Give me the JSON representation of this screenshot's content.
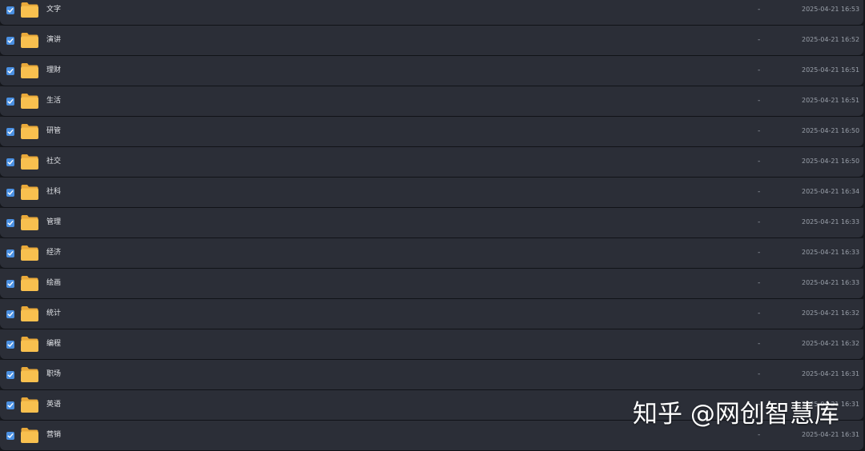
{
  "rows": [
    {
      "name": "文字",
      "size": "-",
      "date": "2025-04-21 16:53",
      "checked": true
    },
    {
      "name": "演讲",
      "size": "-",
      "date": "2025-04-21 16:52",
      "checked": true
    },
    {
      "name": "理财",
      "size": "-",
      "date": "2025-04-21 16:51",
      "checked": true
    },
    {
      "name": "生活",
      "size": "-",
      "date": "2025-04-21 16:51",
      "checked": true
    },
    {
      "name": "研管",
      "size": "-",
      "date": "2025-04-21 16:50",
      "checked": true
    },
    {
      "name": "社交",
      "size": "-",
      "date": "2025-04-21 16:50",
      "checked": true
    },
    {
      "name": "社科",
      "size": "-",
      "date": "2025-04-21 16:34",
      "checked": true
    },
    {
      "name": "管理",
      "size": "-",
      "date": "2025-04-21 16:33",
      "checked": true
    },
    {
      "name": "经济",
      "size": "-",
      "date": "2025-04-21 16:33",
      "checked": true
    },
    {
      "name": "绘画",
      "size": "-",
      "date": "2025-04-21 16:33",
      "checked": true
    },
    {
      "name": "统计",
      "size": "-",
      "date": "2025-04-21 16:32",
      "checked": true
    },
    {
      "name": "编程",
      "size": "-",
      "date": "2025-04-21 16:32",
      "checked": true
    },
    {
      "name": "职场",
      "size": "-",
      "date": "2025-04-21 16:31",
      "checked": true
    },
    {
      "name": "英语",
      "size": "-",
      "date": "2025-04-21 16:31",
      "checked": true
    },
    {
      "name": "营销",
      "size": "-",
      "date": "2025-04-21 16:31",
      "checked": true
    }
  ],
  "watermark": "知乎 @网创智慧库",
  "icons": {
    "checkbox": "checkbox-checked-icon",
    "folder": "folder-icon"
  },
  "colors": {
    "folder": "#f8c04f",
    "checkbox": "#4a90e2",
    "row_bg": "#2b2e37"
  }
}
